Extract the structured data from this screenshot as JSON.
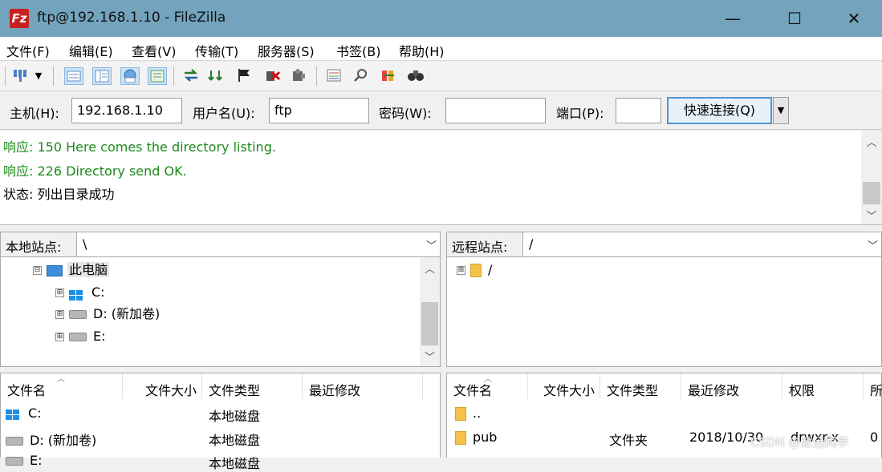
{
  "window": {
    "title": "ftp@192.168.1.10 - FileZilla",
    "app_icon_text": "Fz",
    "controls": {
      "minimize": "—",
      "maximize": "☐",
      "close": "✕"
    }
  },
  "menubar": [
    "文件(F)",
    "编辑(E)",
    "查看(V)",
    "传输(T)",
    "服务器(S)",
    "书签(B)",
    "帮助(H)"
  ],
  "toolbar": {
    "icons": [
      "site-manager-icon",
      "dropdown-arrow-icon",
      "toggle-message-log-icon",
      "toggle-local-tree-icon",
      "toggle-remote-tree-icon",
      "toggle-queue-icon",
      "refresh-icon",
      "process-queue-icon",
      "cancel-operation-icon",
      "disconnect-icon",
      "reconnect-icon",
      "filter-icon",
      "toggle-compare-icon",
      "sync-browse-icon",
      "search-icon"
    ]
  },
  "quickconnect": {
    "host_label": "主机(H):",
    "host_value": "192.168.1.10",
    "user_label": "用户名(U):",
    "user_value": "ftp",
    "pass_label": "密码(W):",
    "pass_value": "",
    "port_label": "端口(P):",
    "port_value": "",
    "connect_label": "快速连接(Q)"
  },
  "log": [
    {
      "prefix": "响应:",
      "text": "150 Here comes the directory listing.",
      "color": "#1c8a1c"
    },
    {
      "prefix": "响应:",
      "text": "226 Directory send OK.",
      "color": "#1c8a1c"
    },
    {
      "prefix": "状态:",
      "text": "列出目录成功",
      "color": "#000000"
    }
  ],
  "local": {
    "site_label": "本地站点:",
    "path": "\\",
    "tree": [
      {
        "label": "此电脑",
        "expander": "⊟"
      },
      {
        "label": "C:",
        "expander": "⊞"
      },
      {
        "label": "D: (新加卷)",
        "expander": "⊞"
      },
      {
        "label": "E:",
        "expander": "⊞"
      }
    ],
    "columns": [
      "文件名",
      "文件大小",
      "文件类型",
      "最近修改"
    ],
    "files": [
      {
        "name": "C:",
        "size": "",
        "type": "本地磁盘",
        "modified": ""
      },
      {
        "name": "D: (新加卷)",
        "size": "",
        "type": "本地磁盘",
        "modified": ""
      },
      {
        "name": "E:",
        "size": "",
        "type": "本地磁盘",
        "modified": ""
      }
    ]
  },
  "remote": {
    "site_label": "远程站点:",
    "path": "/",
    "tree": [
      {
        "label": "/",
        "expander": "⊞"
      }
    ],
    "columns": [
      "文件名",
      "文件大小",
      "文件类型",
      "最近修改",
      "权限",
      "所"
    ],
    "files": [
      {
        "name": "..",
        "size": "",
        "type": "",
        "modified": "",
        "perms": "",
        "owner": ""
      },
      {
        "name": "pub",
        "size": "",
        "type": "文件夹",
        "modified": "2018/10/30",
        "perms": "drwxr-x",
        "owner": "0"
      }
    ]
  },
  "watermark": "CSDN @致远同学"
}
